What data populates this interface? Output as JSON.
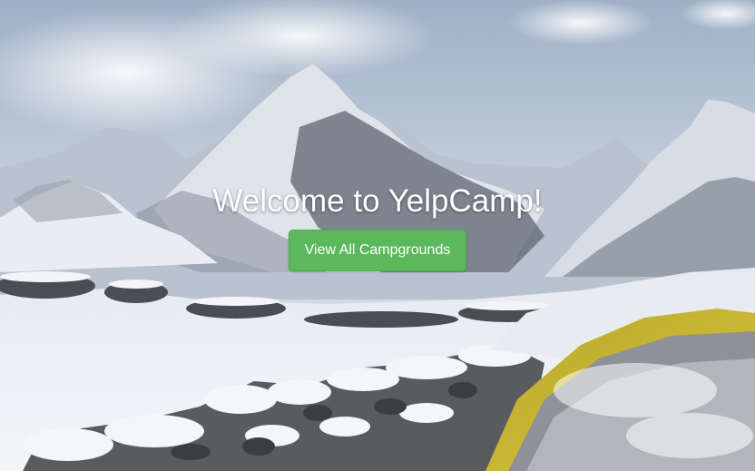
{
  "hero": {
    "title": "Welcome to YelpCamp!",
    "cta_label": "View All Campgrounds",
    "background_image": "snowy-mountain-camp-photo"
  },
  "colors": {
    "cta_background": "#5cb85c",
    "cta_text": "#ffffff",
    "title_text": "#ffffff"
  }
}
